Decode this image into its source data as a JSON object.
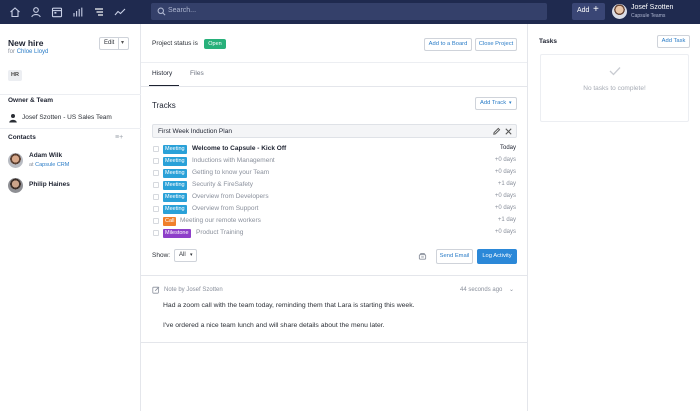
{
  "topbar": {
    "nav_icons": [
      "home-icon",
      "person-icon",
      "calendar-icon",
      "bar-chart-icon",
      "list-icon",
      "trend-icon"
    ],
    "search_placeholder": "Search...",
    "add_label": "Add",
    "user_name": "Josef Szotten",
    "user_org": "Capsule Teams"
  },
  "left": {
    "title": "New hire",
    "for_prefix": "for",
    "for_link": "Chloe Lloyd",
    "edit_label": "Edit",
    "tag": "HR",
    "owner_heading": "Owner & Team",
    "owner_team": "Josef Szotten - US Sales Team",
    "contacts_heading": "Contacts",
    "contacts": [
      {
        "name": "Adam Wilk",
        "sub_prefix": "at",
        "sub_link": "Capsule CRM"
      },
      {
        "name": "Philip Haines"
      }
    ]
  },
  "center": {
    "status_label": "Project status is",
    "status_value": "Open",
    "add_to_board": "Add to a Board",
    "close_project": "Close Project",
    "tabs": [
      {
        "label": "History"
      },
      {
        "label": "Files"
      }
    ],
    "tracks_title": "Tracks",
    "add_track": "Add Track",
    "plan_name": "First Week Induction Plan",
    "tasks": [
      {
        "tag": "Meeting",
        "tag_color": "#2aa1d8",
        "name": "Welcome to Capsule - Kick Off",
        "when": "Today",
        "strong": true
      },
      {
        "tag": "Meeting",
        "tag_color": "#2aa1d8",
        "name": "Inductions with Management",
        "when": "+0 days"
      },
      {
        "tag": "Meeting",
        "tag_color": "#2aa1d8",
        "name": "Getting to know your Team",
        "when": "+0 days"
      },
      {
        "tag": "Meeting",
        "tag_color": "#2aa1d8",
        "name": "Security & FireSafety",
        "when": "+1 day"
      },
      {
        "tag": "Meeting",
        "tag_color": "#2aa1d8",
        "name": "Overview from Developers",
        "when": "+0 days"
      },
      {
        "tag": "Meeting",
        "tag_color": "#2aa1d8",
        "name": "Overview from Support",
        "when": "+0 days"
      },
      {
        "tag": "Call",
        "tag_color": "#f07f2b",
        "name": "Meeting our remote workers",
        "when": "+1 day"
      },
      {
        "tag": "Milestone",
        "tag_color": "#8e3fc9",
        "name": "Product Training",
        "when": "+0 days"
      }
    ],
    "show_label": "Show:",
    "show_value": "All",
    "send_email": "Send Email",
    "log_activity": "Log Activity",
    "note_by": "Note by Josef Szotten",
    "note_time": "44 seconds ago",
    "note_lines": [
      "Had a zoom call with the team today, reminding them that Lara is starting this week.",
      "I've ordered a nice team lunch and will share details about the menu later."
    ]
  },
  "right": {
    "tasks_title": "Tasks",
    "add_task": "Add Task",
    "empty_message": "No tasks to complete!"
  }
}
